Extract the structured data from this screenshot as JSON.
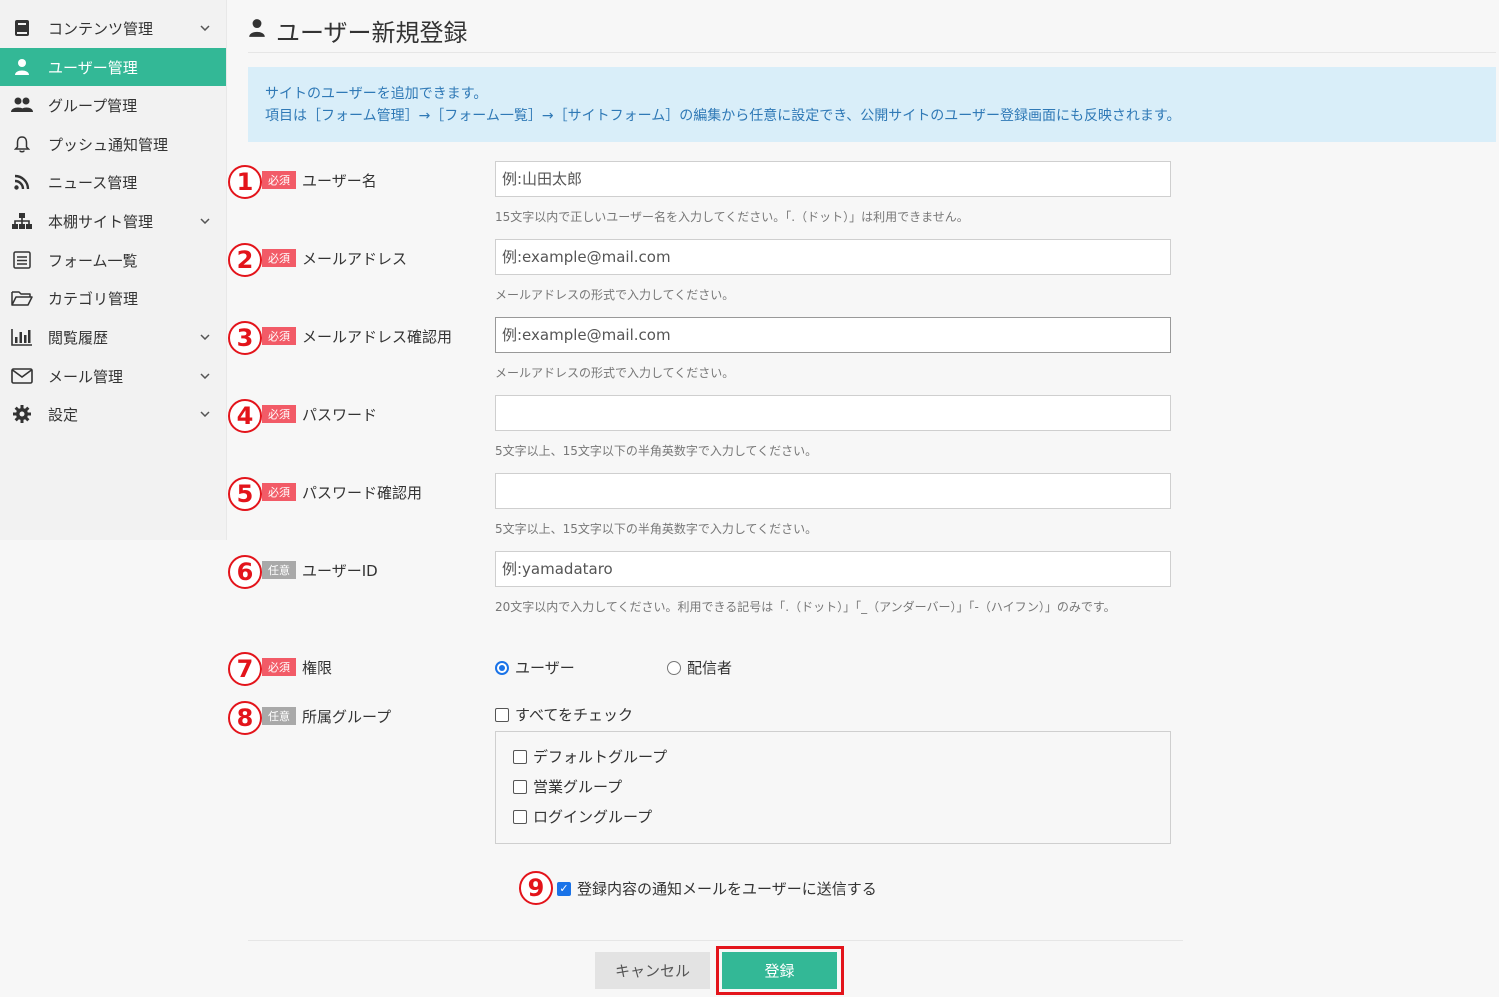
{
  "sidebar": {
    "items": [
      {
        "label": "コンテンツ管理",
        "icon": "book-icon",
        "chevron": true,
        "active": false
      },
      {
        "label": "ユーザー管理",
        "icon": "user-icon",
        "chevron": false,
        "active": true
      },
      {
        "label": "グループ管理",
        "icon": "users-icon",
        "chevron": false,
        "active": false
      },
      {
        "label": "プッシュ通知管理",
        "icon": "bell-icon",
        "chevron": false,
        "active": false
      },
      {
        "label": "ニュース管理",
        "icon": "rss-icon",
        "chevron": false,
        "active": false
      },
      {
        "label": "本棚サイト管理",
        "icon": "sitemap-icon",
        "chevron": true,
        "active": false
      },
      {
        "label": "フォーム一覧",
        "icon": "form-list-icon",
        "chevron": false,
        "active": false
      },
      {
        "label": "カテゴリ管理",
        "icon": "folder-icon",
        "chevron": false,
        "active": false
      },
      {
        "label": "閲覧履歴",
        "icon": "bar-chart-icon",
        "chevron": true,
        "active": false
      },
      {
        "label": "メール管理",
        "icon": "envelope-icon",
        "chevron": true,
        "active": false
      },
      {
        "label": "設定",
        "icon": "gear-icon",
        "chevron": true,
        "active": false
      }
    ],
    "accent": "#33b896"
  },
  "header": {
    "title": "ユーザー新規登録",
    "icon": "user-icon"
  },
  "info": {
    "line1": "サイトのユーザーを追加できます。",
    "line2": "項目は［フォーム管理］→［フォーム一覧］→［サイトフォーム］の編集から任意に設定でき、公開サイトのユーザー登録画面にも反映されます。"
  },
  "badges": {
    "required": "必須",
    "optional": "任意"
  },
  "fields": {
    "username": {
      "num": "1",
      "label": "ユーザー名",
      "placeholder": "例:山田太郎",
      "value": "",
      "help": "15文字以内で正しいユーザー名を入力してください。「.（ドット）」は利用できません。"
    },
    "email": {
      "num": "2",
      "label": "メールアドレス",
      "placeholder": "例:example@mail.com",
      "value": "",
      "help": "メールアドレスの形式で入力してください。"
    },
    "email_confirm": {
      "num": "3",
      "label": "メールアドレス確認用",
      "placeholder": "例:example@mail.com",
      "value": "",
      "help": "メールアドレスの形式で入力してください。"
    },
    "password": {
      "num": "4",
      "label": "パスワード",
      "placeholder": "",
      "value": "",
      "help": "5文字以上、15文字以下の半角英数字で入力してください。"
    },
    "password_confirm": {
      "num": "5",
      "label": "パスワード確認用",
      "placeholder": "",
      "value": "",
      "help": "5文字以上、15文字以下の半角英数字で入力してください。"
    },
    "user_id": {
      "num": "6",
      "label": "ユーザーID",
      "placeholder": "例:yamadataro",
      "value": "",
      "help": "20文字以内で入力してください。利用できる記号は「.（ドット）」「_（アンダーバー）」「-（ハイフン）」のみです。"
    },
    "role": {
      "num": "7",
      "label": "権限",
      "options": [
        "ユーザー",
        "配信者"
      ],
      "selected": "ユーザー"
    },
    "groups": {
      "num": "8",
      "label": "所属グループ",
      "check_all": "すべてをチェック",
      "items": [
        "デフォルトグループ",
        "営業グループ",
        "ログイングループ"
      ]
    }
  },
  "notify": {
    "num": "9",
    "label": "登録内容の通知メールをユーザーに送信する",
    "checked": true
  },
  "buttons": {
    "cancel": "キャンセル",
    "submit": "登録"
  },
  "colors": {
    "annotation": "#e3141b",
    "required_badge": "#f25b67",
    "optional_badge": "#a9a9a9",
    "info_bg": "#d9eef9",
    "info_text": "#2f79b6"
  }
}
